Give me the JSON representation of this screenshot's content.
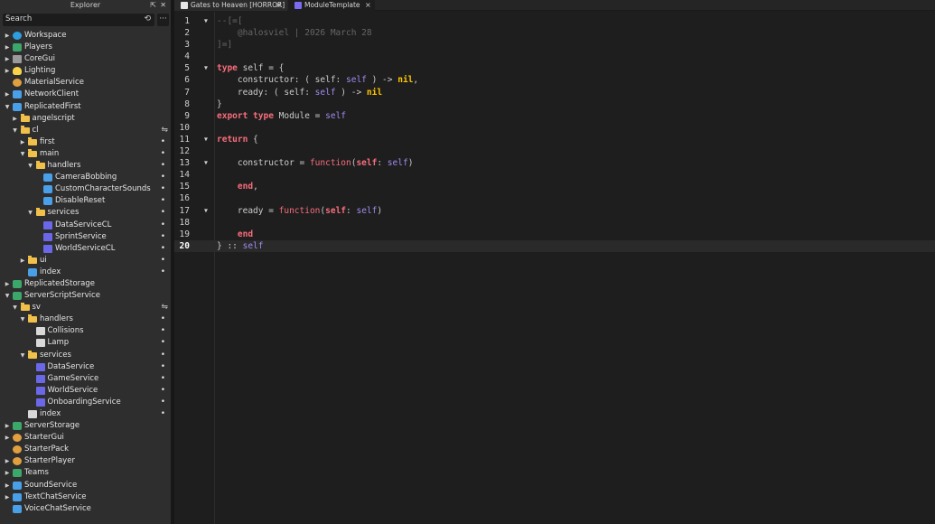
{
  "explorer": {
    "title": "Explorer",
    "search_placeholder": "Search",
    "tree": [
      {
        "label": "Workspace",
        "depth": 0,
        "arrow": "right",
        "icon": "globe"
      },
      {
        "label": "Players",
        "depth": 0,
        "arrow": "right",
        "icon": "svc"
      },
      {
        "label": "CoreGui",
        "depth": 0,
        "arrow": "right",
        "icon": "core"
      },
      {
        "label": "Lighting",
        "depth": 0,
        "arrow": "right",
        "icon": "bulb"
      },
      {
        "label": "MaterialService",
        "depth": 0,
        "arrow": "",
        "icon": "gear"
      },
      {
        "label": "NetworkClient",
        "depth": 0,
        "arrow": "right",
        "icon": "net"
      },
      {
        "label": "ReplicatedFirst",
        "depth": 0,
        "arrow": "down",
        "icon": "net"
      },
      {
        "label": "angelscript",
        "depth": 1,
        "arrow": "right",
        "icon": "folder"
      },
      {
        "label": "cl",
        "depth": 1,
        "arrow": "down",
        "icon": "folder",
        "sync": true
      },
      {
        "label": "first",
        "depth": 2,
        "arrow": "right",
        "icon": "folder",
        "dot": true
      },
      {
        "label": "main",
        "depth": 2,
        "arrow": "down",
        "icon": "folder",
        "dot": true
      },
      {
        "label": "handlers",
        "depth": 3,
        "arrow": "down",
        "icon": "folder",
        "dot": true
      },
      {
        "label": "CameraBobbing",
        "depth": 4,
        "arrow": "",
        "icon": "net",
        "dot": true
      },
      {
        "label": "CustomCharacterSounds",
        "depth": 4,
        "arrow": "",
        "icon": "net",
        "dot": true
      },
      {
        "label": "DisableReset",
        "depth": 4,
        "arrow": "",
        "icon": "net",
        "dot": true
      },
      {
        "label": "services",
        "depth": 3,
        "arrow": "down",
        "icon": "folder",
        "dot": true
      },
      {
        "label": "DataServiceCL",
        "depth": 4,
        "arrow": "",
        "icon": "script",
        "dot": true
      },
      {
        "label": "SprintService",
        "depth": 4,
        "arrow": "",
        "icon": "script",
        "dot": true
      },
      {
        "label": "WorldServiceCL",
        "depth": 4,
        "arrow": "",
        "icon": "script",
        "dot": true
      },
      {
        "label": "ui",
        "depth": 2,
        "arrow": "right",
        "icon": "folder",
        "dot": true
      },
      {
        "label": "index",
        "depth": 2,
        "arrow": "",
        "icon": "net",
        "dot": true
      },
      {
        "label": "ReplicatedStorage",
        "depth": 0,
        "arrow": "right",
        "icon": "svc"
      },
      {
        "label": "ServerScriptService",
        "depth": 0,
        "arrow": "down",
        "icon": "svc"
      },
      {
        "label": "sv",
        "depth": 1,
        "arrow": "down",
        "icon": "folder",
        "sync": true
      },
      {
        "label": "handlers",
        "depth": 2,
        "arrow": "down",
        "icon": "folder",
        "dot": true
      },
      {
        "label": "Collisions",
        "depth": 3,
        "arrow": "",
        "icon": "script-w",
        "dot": true
      },
      {
        "label": "Lamp",
        "depth": 3,
        "arrow": "",
        "icon": "script-w",
        "dot": true
      },
      {
        "label": "services",
        "depth": 2,
        "arrow": "down",
        "icon": "folder",
        "dot": true
      },
      {
        "label": "DataService",
        "depth": 3,
        "arrow": "",
        "icon": "script",
        "dot": true
      },
      {
        "label": "GameService",
        "depth": 3,
        "arrow": "",
        "icon": "script",
        "dot": true
      },
      {
        "label": "WorldService",
        "depth": 3,
        "arrow": "",
        "icon": "script",
        "dot": true
      },
      {
        "label": "OnboardingService",
        "depth": 3,
        "arrow": "",
        "icon": "script",
        "dot": true
      },
      {
        "label": "index",
        "depth": 2,
        "arrow": "",
        "icon": "script-w",
        "dot": true
      },
      {
        "label": "ServerStorage",
        "depth": 0,
        "arrow": "right",
        "icon": "svc"
      },
      {
        "label": "StarterGui",
        "depth": 0,
        "arrow": "right",
        "icon": "gear"
      },
      {
        "label": "StarterPack",
        "depth": 0,
        "arrow": "",
        "icon": "gear"
      },
      {
        "label": "StarterPlayer",
        "depth": 0,
        "arrow": "right",
        "icon": "gear"
      },
      {
        "label": "Teams",
        "depth": 0,
        "arrow": "right",
        "icon": "svc"
      },
      {
        "label": "SoundService",
        "depth": 0,
        "arrow": "right",
        "icon": "net"
      },
      {
        "label": "TextChatService",
        "depth": 0,
        "arrow": "right",
        "icon": "net"
      },
      {
        "label": "VoiceChatService",
        "depth": 0,
        "arrow": "",
        "icon": "net"
      }
    ]
  },
  "tabs": [
    {
      "label": "Gates to Heaven [HORROR]",
      "close": "×",
      "icon_color": "#e6e6e6"
    },
    {
      "label": "ModuleTemplate",
      "close": "×",
      "icon_color": "#7a6cf0"
    }
  ],
  "editor": {
    "current_line": 20,
    "lines": [
      {
        "n": "1",
        "fold": true,
        "tokens": [
          [
            "c-comment",
            "--[=["
          ]
        ]
      },
      {
        "n": "2",
        "tokens": [
          [
            "c-comment",
            "    @halosviel | 2026 March 28"
          ]
        ]
      },
      {
        "n": "3",
        "tokens": [
          [
            "c-comment",
            "]=]"
          ]
        ]
      },
      {
        "n": "4",
        "tokens": []
      },
      {
        "n": "5",
        "fold": true,
        "tokens": [
          [
            "c-kw",
            "type"
          ],
          [
            "c-plain",
            " self = {"
          ]
        ]
      },
      {
        "n": "6",
        "tokens": [
          [
            "c-plain",
            "    constructor: ( self: "
          ],
          [
            "c-self",
            "self"
          ],
          [
            "c-plain",
            " ) -> "
          ],
          [
            "c-nil",
            "nil"
          ],
          [
            "c-plain",
            ","
          ]
        ]
      },
      {
        "n": "7",
        "tokens": [
          [
            "c-plain",
            "    ready: ( self: "
          ],
          [
            "c-self",
            "self"
          ],
          [
            "c-plain",
            " ) -> "
          ],
          [
            "c-nil",
            "nil"
          ]
        ]
      },
      {
        "n": "8",
        "tokens": [
          [
            "c-plain",
            "}"
          ]
        ]
      },
      {
        "n": "9",
        "tokens": [
          [
            "c-kw",
            "export type"
          ],
          [
            "c-plain",
            " Module = "
          ],
          [
            "c-self",
            "self"
          ]
        ]
      },
      {
        "n": "10",
        "tokens": []
      },
      {
        "n": "11",
        "fold": true,
        "tokens": [
          [
            "c-kw",
            "return"
          ],
          [
            "c-plain",
            " {"
          ]
        ]
      },
      {
        "n": "12",
        "tokens": []
      },
      {
        "n": "13",
        "fold": true,
        "tokens": [
          [
            "c-plain",
            "    constructor = "
          ],
          [
            "c-fn",
            "function"
          ],
          [
            "c-plain",
            "("
          ],
          [
            "c-kw",
            "self"
          ],
          [
            "c-plain",
            ": "
          ],
          [
            "c-self",
            "self"
          ],
          [
            "c-plain",
            ")"
          ]
        ]
      },
      {
        "n": "14",
        "tokens": []
      },
      {
        "n": "15",
        "tokens": [
          [
            "c-plain",
            "    "
          ],
          [
            "c-kw",
            "end"
          ],
          [
            "c-plain",
            ","
          ]
        ]
      },
      {
        "n": "16",
        "tokens": []
      },
      {
        "n": "17",
        "fold": true,
        "tokens": [
          [
            "c-plain",
            "    ready = "
          ],
          [
            "c-fn",
            "function"
          ],
          [
            "c-plain",
            "("
          ],
          [
            "c-kw",
            "self"
          ],
          [
            "c-plain",
            ": "
          ],
          [
            "c-self",
            "self"
          ],
          [
            "c-plain",
            ")"
          ]
        ]
      },
      {
        "n": "18",
        "tokens": []
      },
      {
        "n": "19",
        "tokens": [
          [
            "c-plain",
            "    "
          ],
          [
            "c-kw",
            "end"
          ]
        ]
      },
      {
        "n": "20",
        "tokens": [
          [
            "c-plain",
            "} :: "
          ],
          [
            "c-self",
            "self"
          ]
        ]
      }
    ]
  }
}
